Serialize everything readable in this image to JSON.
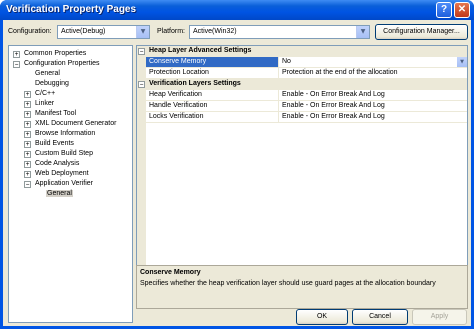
{
  "window": {
    "title": "Verification Property Pages",
    "help_glyph": "?",
    "close_glyph": "✕"
  },
  "toolbar": {
    "configuration_label": "Configuration:",
    "configuration_value": "Active(Debug)",
    "platform_label": "Platform:",
    "platform_value": "Active(Win32)",
    "config_manager_label": "Configuration Manager..."
  },
  "tree": {
    "common_properties": "Common Properties",
    "configuration_properties": "Configuration Properties",
    "children": [
      {
        "label": "General",
        "expandable": false
      },
      {
        "label": "Debugging",
        "expandable": false
      },
      {
        "label": "C/C++",
        "expandable": true
      },
      {
        "label": "Linker",
        "expandable": true
      },
      {
        "label": "Manifest Tool",
        "expandable": true
      },
      {
        "label": "XML Document Generator",
        "expandable": true
      },
      {
        "label": "Browse Information",
        "expandable": true
      },
      {
        "label": "Build Events",
        "expandable": true
      },
      {
        "label": "Custom Build Step",
        "expandable": true
      },
      {
        "label": "Code Analysis",
        "expandable": true
      },
      {
        "label": "Web Deployment",
        "expandable": true
      }
    ],
    "application_verifier": "Application Verifier",
    "app_verifier_general": "General",
    "plus": "+",
    "minus": "−"
  },
  "grid": {
    "heap_category": "Heap Layer Advanced Settings",
    "heap_rows": [
      {
        "name": "Conserve Memory",
        "value": "No",
        "selected": true
      },
      {
        "name": "Protection Location",
        "value": "Protection at the end of the allocation",
        "selected": false
      }
    ],
    "verification_category": "Verification Layers Settings",
    "verification_rows": [
      {
        "name": "Heap Verification",
        "value": "Enable - On Error Break And Log"
      },
      {
        "name": "Handle Verification",
        "value": "Enable - On Error Break And Log"
      },
      {
        "name": "Locks Verification",
        "value": "Enable - On Error Break And Log"
      }
    ]
  },
  "description": {
    "title": "Conserve Memory",
    "text": "Specifies whether the heap verification layer should use guard pages at the allocation boundary"
  },
  "buttons": {
    "ok": "OK",
    "cancel": "Cancel",
    "apply": "Apply"
  },
  "colors": {
    "title_bar": "#0054e3",
    "selection": "#316ac5",
    "dialog_face": "#ece9d8"
  }
}
